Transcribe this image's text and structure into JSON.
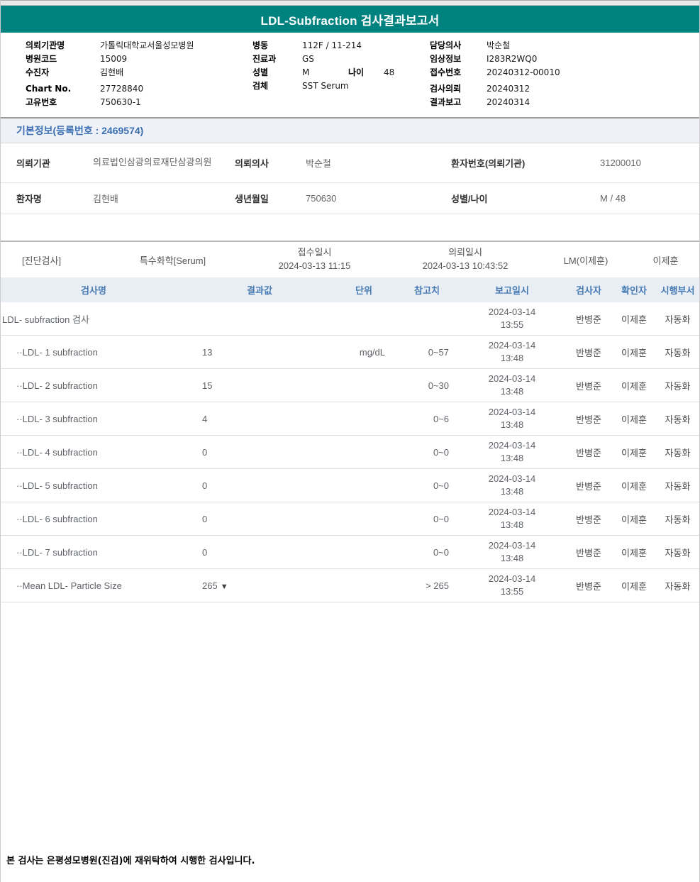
{
  "title": "LDL-Subfraction 검사결과보고서",
  "patient_header": {
    "left": [
      {
        "label": "의뢰기관명",
        "value": "가톨릭대학교서울성모병원"
      },
      {
        "label": "병원코드",
        "value": "15009"
      },
      {
        "label": "수진자",
        "value": "김현배"
      },
      {
        "label": "Chart No.",
        "value": "27728840"
      },
      {
        "label": "고유번호",
        "value": "750630-1"
      }
    ],
    "middle": [
      {
        "label": "병동",
        "value": "112F / 11-214"
      },
      {
        "label": "진료과",
        "value": "GS"
      },
      {
        "label": "성별",
        "value": "M",
        "label2": "나이",
        "value2": "48"
      },
      {
        "label": "검체",
        "value": "SST Serum"
      }
    ],
    "right": [
      {
        "label": "담당의사",
        "value": "박순철"
      },
      {
        "label": "임상정보",
        "value": "I283R2WQ0"
      },
      {
        "label": "접수번호",
        "value": "20240312-00010"
      },
      {
        "label": "검사의뢰",
        "value": "20240312"
      },
      {
        "label": "결과보고",
        "value": "20240314"
      }
    ]
  },
  "basic_info": {
    "header": "기본정보(등록번호 : 2469574)",
    "row1": {
      "label1": "의뢰기관",
      "value1": "의료법인삼광의료재단삼광의원",
      "label2": "의뢰의사",
      "value2": "박순철",
      "label3": "환자번호(의뢰기관)",
      "value3": "31200010"
    },
    "row2": {
      "label1": "환자명",
      "value1": "김현배",
      "label2": "생년월일",
      "value2": "750630",
      "label3": "성별/나이",
      "value3": "M / 48"
    }
  },
  "section_bar": {
    "dept": "[진단검사]",
    "category": "특수화학[Serum]",
    "receipt_label": "접수일시",
    "receipt_time": "2024-03-13 11:15",
    "request_label": "의뢰일시",
    "request_time": "2024-03-13 10:43:52",
    "lm": "LM(이제훈)",
    "approver": "이제훈"
  },
  "results_table": {
    "columns": {
      "name": "검사명",
      "result": "결과값",
      "unit": "단위",
      "ref": "참고치",
      "reported": "보고일시",
      "tester": "검사자",
      "verifier": "확인자",
      "dept": "시행부서"
    },
    "rows": [
      {
        "name": "LDL- subfraction 검사",
        "result": "",
        "flag": "",
        "unit": "",
        "ref": "",
        "reported_date": "2024-03-14",
        "reported_time": "13:55",
        "tester": "반병준",
        "verifier": "이제훈",
        "dept": "자동화"
      },
      {
        "name": "··LDL- 1 subfraction",
        "result": "13",
        "flag": "",
        "unit": "mg/dL",
        "ref": "0~57",
        "reported_date": "2024-03-14",
        "reported_time": "13:48",
        "tester": "반병준",
        "verifier": "이제훈",
        "dept": "자동화"
      },
      {
        "name": "··LDL- 2 subfraction",
        "result": "15",
        "flag": "",
        "unit": "",
        "ref": "0~30",
        "reported_date": "2024-03-14",
        "reported_time": "13:48",
        "tester": "반병준",
        "verifier": "이제훈",
        "dept": "자동화"
      },
      {
        "name": "··LDL- 3 subfraction",
        "result": "4",
        "flag": "",
        "unit": "",
        "ref": "0~6",
        "reported_date": "2024-03-14",
        "reported_time": "13:48",
        "tester": "반병준",
        "verifier": "이제훈",
        "dept": "자동화"
      },
      {
        "name": "··LDL- 4 subfraction",
        "result": "0",
        "flag": "",
        "unit": "",
        "ref": "0~0",
        "reported_date": "2024-03-14",
        "reported_time": "13:48",
        "tester": "반병준",
        "verifier": "이제훈",
        "dept": "자동화"
      },
      {
        "name": "··LDL- 5 subfraction",
        "result": "0",
        "flag": "",
        "unit": "",
        "ref": "0~0",
        "reported_date": "2024-03-14",
        "reported_time": "13:48",
        "tester": "반병준",
        "verifier": "이제훈",
        "dept": "자동화"
      },
      {
        "name": "··LDL- 6 subfraction",
        "result": "0",
        "flag": "",
        "unit": "",
        "ref": "0~0",
        "reported_date": "2024-03-14",
        "reported_time": "13:48",
        "tester": "반병준",
        "verifier": "이제훈",
        "dept": "자동화"
      },
      {
        "name": "··LDL- 7 subfraction",
        "result": "0",
        "flag": "",
        "unit": "",
        "ref": "0~0",
        "reported_date": "2024-03-14",
        "reported_time": "13:48",
        "tester": "반병준",
        "verifier": "이제훈",
        "dept": "자동화"
      },
      {
        "name": "··Mean LDL- Particle Size",
        "result": "265",
        "flag": "▼",
        "unit": "",
        "ref": "> 265",
        "reported_date": "2024-03-14",
        "reported_time": "13:55",
        "tester": "반병준",
        "verifier": "이제훈",
        "dept": "자동화"
      }
    ]
  },
  "footer_note": "본 검사는 은평성모병원(진검)에 재위탁하여 시행한 검사입니다.",
  "colors": {
    "accent_teal": "#00827e",
    "header_blue_text": "#4679b2",
    "header_blue_bg": "#e9eef4",
    "basic_bar_bg": "#eef2f8"
  }
}
